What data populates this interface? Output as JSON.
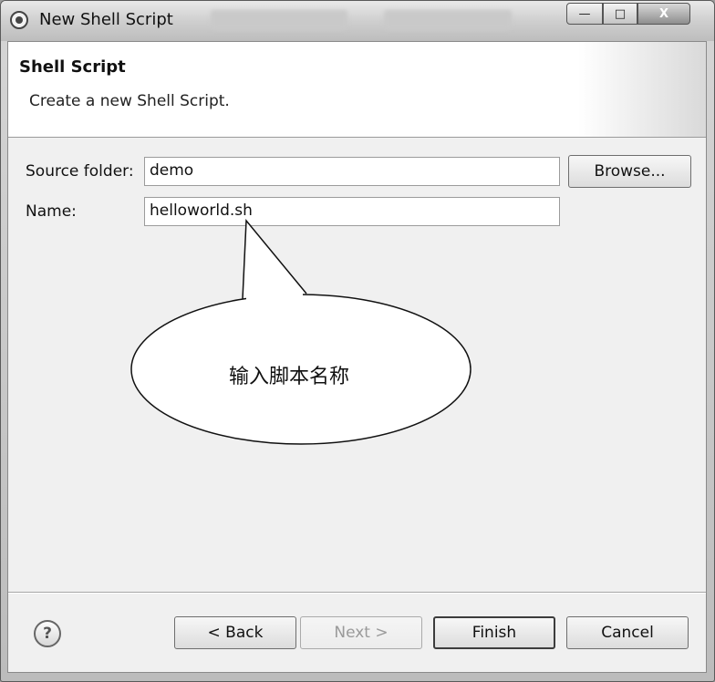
{
  "window": {
    "title": "New Shell Script",
    "buttons": {
      "minimize": "—",
      "maximize": "□",
      "close": "X"
    }
  },
  "header": {
    "title": "Shell Script",
    "description": "Create a new Shell Script."
  },
  "form": {
    "source_folder_label": "Source folder:",
    "source_folder_value": "demo",
    "browse_label": "Browse...",
    "name_label": "Name:",
    "name_value": "helloworld.sh"
  },
  "callout": {
    "text": "输入脚本名称"
  },
  "footer": {
    "help_glyph": "?",
    "back_label": "< Back",
    "next_label": "Next >",
    "finish_label": "Finish",
    "cancel_label": "Cancel"
  },
  "icons": [
    "app-icon",
    "minimize-icon",
    "maximize-icon",
    "close-icon",
    "help-icon"
  ]
}
